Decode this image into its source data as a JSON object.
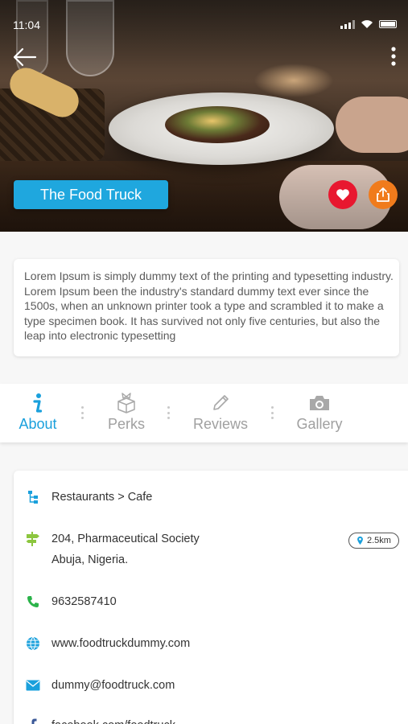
{
  "status_bar": {
    "time": "11:04"
  },
  "hero": {
    "title": "The Food Truck",
    "favorite_color": "#e8172f",
    "share_color": "#f07b1c"
  },
  "description": "Lorem Ipsum is simply dummy text of the printing and typesetting industry. Lorem Ipsum been the industry's standard dummy text ever since the 1500s, when an unknown printer took a type and scrambled it to make a type specimen book. It has survived not only five centuries, but also the leap into electronic typesetting",
  "tabs": [
    {
      "label": "About",
      "icon": "info-icon",
      "active": true
    },
    {
      "label": "Perks",
      "icon": "gift-box-icon",
      "active": false
    },
    {
      "label": "Reviews",
      "icon": "pencil-icon",
      "active": false
    },
    {
      "label": "Gallery",
      "icon": "camera-icon",
      "active": false
    }
  ],
  "info": {
    "category": "Restaurants > Cafe",
    "address_line1": "204, Pharmaceutical Society",
    "address_line2": "Abuja, Nigeria.",
    "distance": "2.5km",
    "phone": "9632587410",
    "website": "www.foodtruckdummy.com",
    "email": "dummy@foodtruck.com",
    "facebook": "facebook.com/foodtruck"
  },
  "colors": {
    "accent": "#1aa0dc",
    "phone_icon": "#2bb34a",
    "address_icon": "#8cc63f"
  }
}
